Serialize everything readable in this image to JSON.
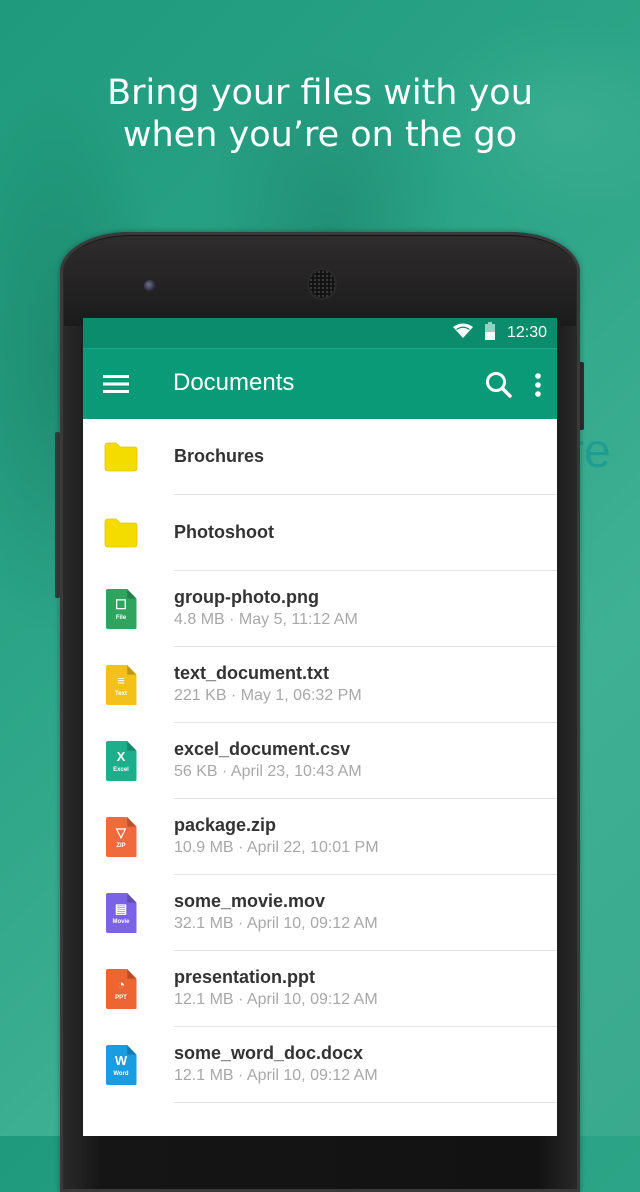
{
  "promo": {
    "headline_line1": "Bring your files with you",
    "headline_line2": "when you’re on the go",
    "background_partial_word": "re"
  },
  "status_bar": {
    "time": "12:30",
    "icons": [
      "wifi-icon",
      "battery-icon"
    ]
  },
  "app_bar": {
    "title": "Documents",
    "left_icon": "menu-icon",
    "right_icons": [
      "search-icon",
      "more-vert-icon"
    ]
  },
  "colors": {
    "primary": "#0a9a77",
    "primary_dark": "#0b8c6c",
    "folder": "#f5dc00",
    "image_file": "#2fa45e",
    "text_file": "#f2c21b",
    "excel_file": "#1dae8c",
    "zip_file": "#ef6a3d",
    "movie_file": "#7b63e6",
    "ppt_file": "#ee6534",
    "word_file": "#1a9de0"
  },
  "items": [
    {
      "type": "folder",
      "name": "Brochures",
      "icon": "folder-icon"
    },
    {
      "type": "folder",
      "name": "Photoshoot",
      "icon": "folder-icon"
    },
    {
      "type": "file",
      "name": "group-photo.png",
      "meta": "4.8 MB · May 5, 11:12 AM",
      "icon": "image-file-icon",
      "badge": "File",
      "glyph": "☐",
      "color": "#2fa45e"
    },
    {
      "type": "file",
      "name": "text_document.txt",
      "meta": "221 KB · May 1, 06:32 PM",
      "icon": "text-file-icon",
      "badge": "Text",
      "glyph": "≡",
      "color": "#f2c21b"
    },
    {
      "type": "file",
      "name": "excel_document.csv",
      "meta": "56 KB · April 23, 10:43 AM",
      "icon": "excel-file-icon",
      "badge": "Excel",
      "glyph": "X",
      "color": "#1dae8c"
    },
    {
      "type": "file",
      "name": "package.zip",
      "meta": "10.9 MB · April 22, 10:01 PM",
      "icon": "zip-file-icon",
      "badge": "ZIP",
      "glyph": "▽",
      "color": "#ef6a3d"
    },
    {
      "type": "file",
      "name": "some_movie.mov",
      "meta": "32.1 MB · April 10, 09:12 AM",
      "icon": "movie-file-icon",
      "badge": "Movie",
      "glyph": "▤",
      "color": "#7b63e6"
    },
    {
      "type": "file",
      "name": "presentation.ppt",
      "meta": "12.1 MB · April 10, 09:12 AM",
      "icon": "ppt-file-icon",
      "badge": "PPT",
      "glyph": "◔",
      "color": "#ee6534"
    },
    {
      "type": "file",
      "name": "some_word_doc.docx",
      "meta": "12.1 MB · April 10, 09:12 AM",
      "icon": "word-file-icon",
      "badge": "Word",
      "glyph": "W",
      "color": "#1a9de0"
    }
  ]
}
